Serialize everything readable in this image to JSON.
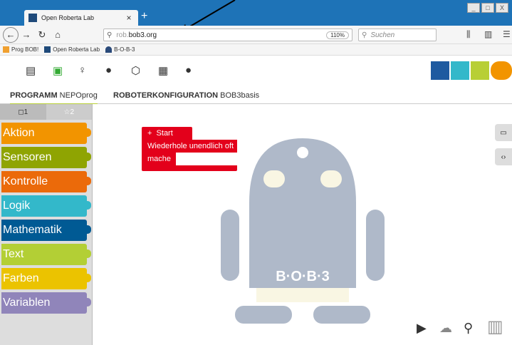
{
  "browser": {
    "tab_title": "Open Roberta Lab",
    "tab_close": "×",
    "new_tab": "+",
    "url_prefix": "rob.",
    "url_host": "bob3.org",
    "zoom": "110%",
    "search_placeholder": "Suchen"
  },
  "bookmarks": [
    {
      "label": "Prog BOB!",
      "color": "#f0a030"
    },
    {
      "label": "Open Roberta Lab",
      "color": "#1f4a7a"
    },
    {
      "label": "B-O-B-3",
      "color": "#2a4a7a"
    }
  ],
  "tabs": {
    "program_bold": "PROGRAMM",
    "program_name": "NEPOprog",
    "robot_bold": "ROBOTERKONFIGURATION",
    "robot_name": "BOB3basis"
  },
  "sidebar": {
    "tab1": "◻1",
    "tab2": "☆2",
    "categories": [
      {
        "label": "Aktion",
        "color": "#f29400"
      },
      {
        "label": "Sensoren",
        "color": "#8fa402"
      },
      {
        "label": "Kontrolle",
        "color": "#eb6a0a"
      },
      {
        "label": "Logik",
        "color": "#33b8ca"
      },
      {
        "label": "Mathematik",
        "color": "#005a94"
      },
      {
        "label": "Text",
        "color": "#b3cf35"
      },
      {
        "label": "Farben",
        "color": "#ebc300"
      },
      {
        "label": "Variablen",
        "color": "#9085ba"
      }
    ]
  },
  "blocks": {
    "start": "Start",
    "repeat": "Wiederhole unendlich oft",
    "do": "mache"
  },
  "robot_label": "B·O·B·3",
  "colors": {
    "block_red": "#e3001b",
    "tabbar": "#1e73b7",
    "active_tab_underline": "#b8cf35"
  }
}
